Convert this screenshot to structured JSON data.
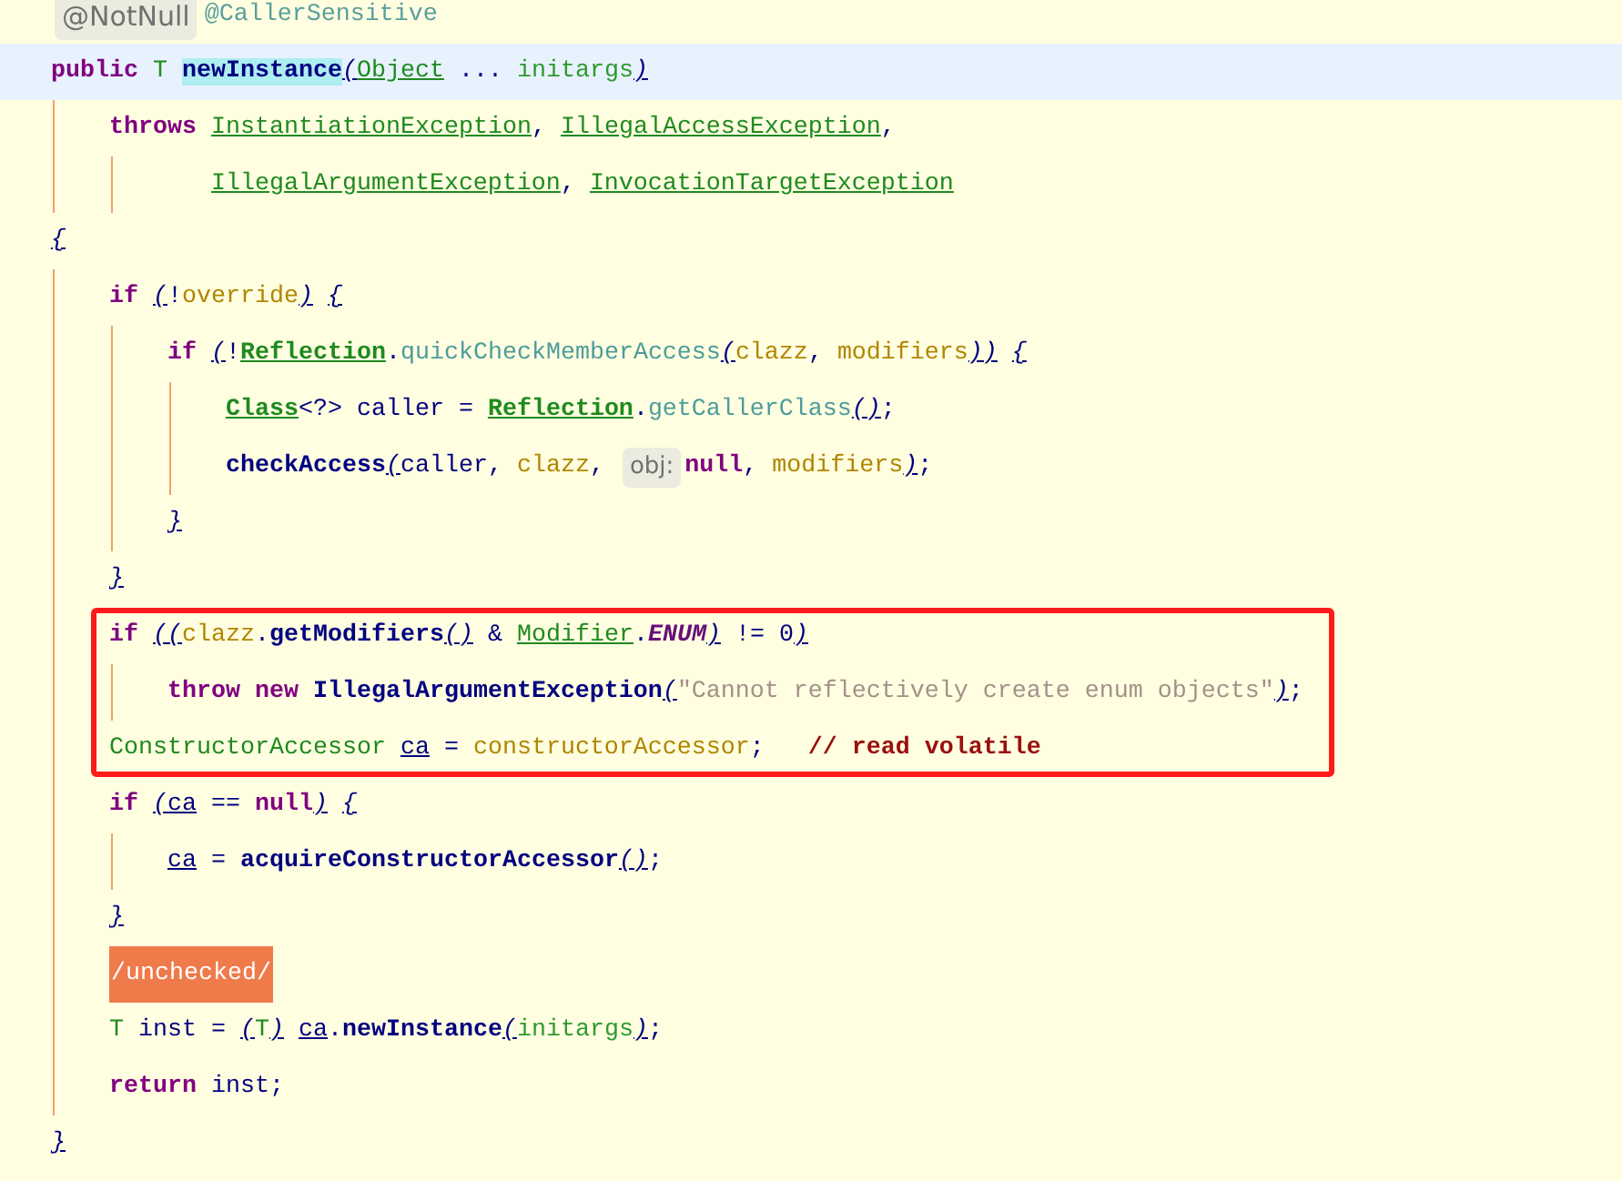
{
  "lines": [
    {
      "kind": "top",
      "current": false,
      "boxed": false,
      "tokens": [
        {
          "kind": "hint_large",
          "text": "@NotNull"
        },
        {
          "kind": "annotation",
          "text": "@CallerSensitive"
        }
      ]
    },
    {
      "kind": "top",
      "current": true,
      "boxed": false,
      "tokens": [
        {
          "kind": "keyword",
          "text": "public "
        },
        {
          "kind": "type",
          "text": "T "
        },
        {
          "kind": "method_decl",
          "text": "newInstance"
        },
        {
          "kind": "paren",
          "text": "("
        },
        {
          "kind": "type_link",
          "text": "Object"
        },
        {
          "kind": "plain",
          "text": " ... "
        },
        {
          "kind": "param",
          "text": "initargs"
        },
        {
          "kind": "paren",
          "text": ")"
        }
      ]
    },
    {
      "kind": "level1",
      "current": false,
      "boxed": false,
      "tokens": [
        {
          "kind": "keyword",
          "text": "throws "
        },
        {
          "kind": "type_link",
          "text": "InstantiationException"
        },
        {
          "kind": "plain",
          "text": ", "
        },
        {
          "kind": "type_link",
          "text": "IllegalAccessException"
        },
        {
          "kind": "plain",
          "text": ","
        }
      ]
    },
    {
      "kind": "continuation",
      "current": false,
      "boxed": false,
      "tokens": [
        {
          "kind": "type_link",
          "text": "IllegalArgumentException"
        },
        {
          "kind": "plain",
          "text": ", "
        },
        {
          "kind": "type_link",
          "text": "InvocationTargetException"
        }
      ]
    },
    {
      "kind": "top",
      "current": false,
      "boxed": false,
      "tokens": [
        {
          "kind": "paren",
          "text": "{"
        }
      ]
    },
    {
      "kind": "level1",
      "current": false,
      "boxed": false,
      "tokens": [
        {
          "kind": "keyword",
          "text": "if "
        },
        {
          "kind": "paren",
          "text": "("
        },
        {
          "kind": "plain",
          "text": "!"
        },
        {
          "kind": "field",
          "text": "override"
        },
        {
          "kind": "paren",
          "text": ")"
        },
        {
          "kind": "paren",
          "text": " {"
        }
      ]
    },
    {
      "kind": "level2",
      "current": false,
      "boxed": false,
      "tokens": [
        {
          "kind": "keyword",
          "text": "if "
        },
        {
          "kind": "paren",
          "text": "("
        },
        {
          "kind": "plain",
          "text": "!"
        },
        {
          "kind": "type_link_bold",
          "text": "Reflection"
        },
        {
          "kind": "plain",
          "text": "."
        },
        {
          "kind": "static_call",
          "text": "quickCheckMemberAccess"
        },
        {
          "kind": "paren",
          "text": "("
        },
        {
          "kind": "field",
          "text": "clazz"
        },
        {
          "kind": "plain",
          "text": ", "
        },
        {
          "kind": "field",
          "text": "modifiers"
        },
        {
          "kind": "paren",
          "text": "))"
        },
        {
          "kind": "paren",
          "text": " {"
        }
      ]
    },
    {
      "kind": "level3",
      "current": false,
      "boxed": false,
      "tokens": [
        {
          "kind": "type_link_bold",
          "text": "Class"
        },
        {
          "kind": "plain",
          "text": "<?> caller = "
        },
        {
          "kind": "type_link_bold",
          "text": "Reflection"
        },
        {
          "kind": "plain",
          "text": "."
        },
        {
          "kind": "static_call",
          "text": "getCallerClass"
        },
        {
          "kind": "paren",
          "text": "()"
        },
        {
          "kind": "plain",
          "text": ";"
        }
      ]
    },
    {
      "kind": "level3",
      "current": false,
      "boxed": false,
      "tokens": [
        {
          "kind": "method_call",
          "text": "checkAccess"
        },
        {
          "kind": "paren",
          "text": "("
        },
        {
          "kind": "plain",
          "text": "caller, "
        },
        {
          "kind": "field",
          "text": "clazz"
        },
        {
          "kind": "plain",
          "text": ", "
        },
        {
          "kind": "hint",
          "text": "obj:"
        },
        {
          "kind": "keyword",
          "text": "null"
        },
        {
          "kind": "plain",
          "text": ", "
        },
        {
          "kind": "field",
          "text": "modifiers"
        },
        {
          "kind": "paren",
          "text": ")"
        },
        {
          "kind": "plain",
          "text": ";"
        }
      ]
    },
    {
      "kind": "level2",
      "current": false,
      "boxed": false,
      "tokens": [
        {
          "kind": "paren",
          "text": "}"
        }
      ]
    },
    {
      "kind": "level1",
      "current": false,
      "boxed": false,
      "tokens": [
        {
          "kind": "paren",
          "text": "}"
        }
      ]
    },
    {
      "kind": "level1",
      "current": false,
      "boxed": true,
      "tokens": [
        {
          "kind": "keyword",
          "text": "if "
        },
        {
          "kind": "paren",
          "text": "(("
        },
        {
          "kind": "field",
          "text": "clazz"
        },
        {
          "kind": "plain",
          "text": "."
        },
        {
          "kind": "method_call",
          "text": "getModifiers"
        },
        {
          "kind": "paren",
          "text": "()"
        },
        {
          "kind": "plain",
          "text": " & "
        },
        {
          "kind": "type_link",
          "text": "Modifier"
        },
        {
          "kind": "plain",
          "text": "."
        },
        {
          "kind": "constant",
          "text": "ENUM"
        },
        {
          "kind": "paren",
          "text": ")"
        },
        {
          "kind": "plain",
          "text": " != 0"
        },
        {
          "kind": "paren",
          "text": ")"
        }
      ]
    },
    {
      "kind": "level2",
      "current": false,
      "boxed": true,
      "tokens": [
        {
          "kind": "keyword",
          "text": "throw new "
        },
        {
          "kind": "method_call",
          "text": "IllegalArgumentException"
        },
        {
          "kind": "paren",
          "text": "("
        },
        {
          "kind": "string",
          "text": "\"Cannot reflectively create enum objects\""
        },
        {
          "kind": "paren",
          "text": ")"
        },
        {
          "kind": "plain",
          "text": ";"
        }
      ]
    },
    {
      "kind": "level1",
      "current": false,
      "boxed": true,
      "tokens": [
        {
          "kind": "type",
          "text": "ConstructorAccessor "
        },
        {
          "kind": "local_link",
          "text": "ca"
        },
        {
          "kind": "plain",
          "text": " = "
        },
        {
          "kind": "field",
          "text": "constructorAccessor"
        },
        {
          "kind": "plain",
          "text": ";   "
        },
        {
          "kind": "comment",
          "text": "// read volatile"
        }
      ]
    },
    {
      "kind": "level1",
      "current": false,
      "boxed": false,
      "tokens": [
        {
          "kind": "keyword",
          "text": "if "
        },
        {
          "kind": "paren",
          "text": "("
        },
        {
          "kind": "local_link",
          "text": "ca"
        },
        {
          "kind": "plain",
          "text": " == "
        },
        {
          "kind": "keyword",
          "text": "null"
        },
        {
          "kind": "paren",
          "text": ")"
        },
        {
          "kind": "paren",
          "text": " {"
        }
      ]
    },
    {
      "kind": "level2",
      "current": false,
      "boxed": false,
      "tokens": [
        {
          "kind": "local_link",
          "text": "ca"
        },
        {
          "kind": "plain",
          "text": " = "
        },
        {
          "kind": "method_call",
          "text": "acquireConstructorAccessor"
        },
        {
          "kind": "paren",
          "text": "()"
        },
        {
          "kind": "plain",
          "text": ";"
        }
      ]
    },
    {
      "kind": "level1",
      "current": false,
      "boxed": false,
      "tokens": [
        {
          "kind": "paren",
          "text": "}"
        }
      ]
    },
    {
      "kind": "level1",
      "current": false,
      "boxed": false,
      "tokens": [
        {
          "kind": "marker",
          "text": "/unchecked/"
        }
      ]
    },
    {
      "kind": "level1",
      "current": false,
      "boxed": false,
      "tokens": [
        {
          "kind": "type",
          "text": "T"
        },
        {
          "kind": "plain",
          "text": " inst = "
        },
        {
          "kind": "paren",
          "text": "("
        },
        {
          "kind": "type",
          "text": "T"
        },
        {
          "kind": "paren",
          "text": ")"
        },
        {
          "kind": "local_link",
          "text": " ca"
        },
        {
          "kind": "plain",
          "text": "."
        },
        {
          "kind": "method_call",
          "text": "newInstance"
        },
        {
          "kind": "paren",
          "text": "("
        },
        {
          "kind": "param",
          "text": "initargs"
        },
        {
          "kind": "paren",
          "text": ")"
        },
        {
          "kind": "plain",
          "text": ";"
        }
      ]
    },
    {
      "kind": "level1",
      "current": false,
      "boxed": false,
      "tokens": [
        {
          "kind": "keyword",
          "text": "return"
        },
        {
          "kind": "plain",
          "text": " inst;"
        }
      ]
    },
    {
      "kind": "top",
      "current": false,
      "boxed": false,
      "tokens": [
        {
          "kind": "paren",
          "text": "}"
        }
      ]
    }
  ]
}
